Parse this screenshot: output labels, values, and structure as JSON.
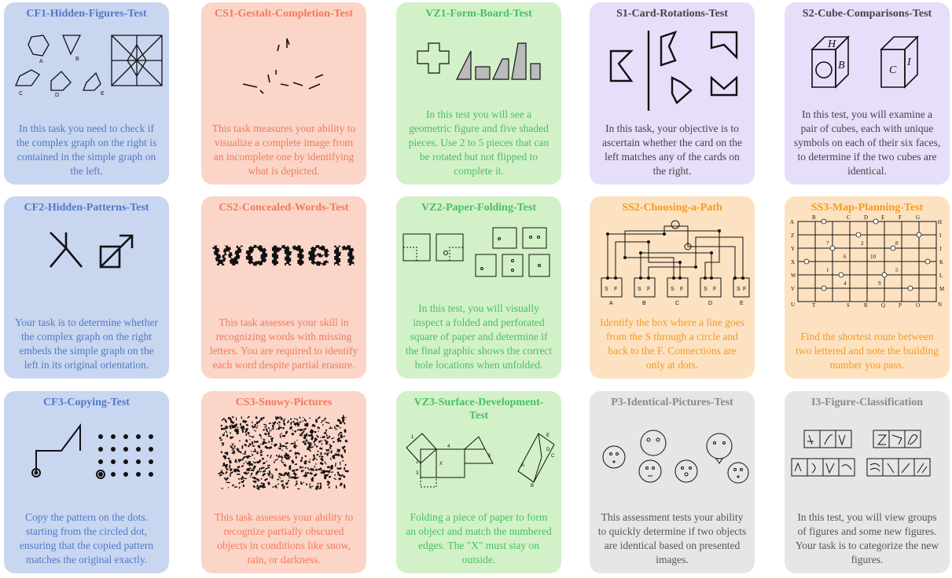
{
  "cards": [
    {
      "id": "cf1",
      "title": "CF1-Hidden-Figures-Test",
      "desc": "In this task you need to check if the complex graph on the right is contained in the simple graph on the left.",
      "color": "blue",
      "fig_labels": [
        "A",
        "B",
        "C",
        "D",
        "E"
      ]
    },
    {
      "id": "cs1",
      "title": "CS1-Gestalt-Completion-Test",
      "desc": "This task measures your ability to visualize a complete image from an incomplete one by identifying what is depicted.",
      "color": "red"
    },
    {
      "id": "vz1",
      "title": "VZ1-Form-Board-Test",
      "desc": "In this test you will see a geometric figure and five shaded pieces. Use 2 to 5 pieces that can be rotated but not flipped to complete it.",
      "color": "green"
    },
    {
      "id": "s1",
      "title": "S1-Card-Rotations-Test",
      "desc": "In this task, your objective is to ascertain whether the card on the left matches any of the cards on the right.",
      "color": "purple"
    },
    {
      "id": "s2",
      "title": "S2-Cube-Comparisons-Test",
      "desc": "In this test, you will examine a pair of cubes, each with unique symbols on each of their six faces, to determine if the two cubes are identical.",
      "color": "purple",
      "fig_labels": [
        "H",
        "B",
        "C",
        "I"
      ]
    },
    {
      "id": "cf2",
      "title": "CF2-Hidden-Patterns-Test",
      "desc": "Your task is to determine whether the complex graph on the right embeds the simple graph on the left in its original orientation.",
      "color": "blue"
    },
    {
      "id": "cs2",
      "title": "CS2-Concealed-Words-Test",
      "desc": "This task assesses your skill in recognizing words with missing letters. You are required to identify each word despite partial erasure.",
      "color": "red",
      "fig_labels": [
        "women"
      ]
    },
    {
      "id": "vz2",
      "title": "VZ2-Paper-Folding-Test",
      "desc": "In this test, you will visually inspect a folded and perforated square of paper and determine if the final graphic shows the correct hole locations when unfolded.",
      "color": "green"
    },
    {
      "id": "ss2",
      "title": "SS2-Choosing-a-Path",
      "desc": "Identify the box where a line goes from the S through a circle and back to the F. Connections are only at dots.",
      "color": "orange",
      "fig_labels": [
        "S",
        "F",
        "A",
        "B",
        "C",
        "D",
        "E"
      ]
    },
    {
      "id": "ss3",
      "title": "SS3-Map-Planning-Test",
      "desc": "Find the shortest route between two lettered and note the building number you pass.",
      "color": "orange",
      "fig_labels": [
        "A",
        "B",
        "C",
        "D",
        "E",
        "F",
        "G",
        "H",
        "I",
        "J",
        "K",
        "L",
        "M",
        "N",
        "O",
        "P",
        "Q",
        "R",
        "S",
        "T",
        "U",
        "V",
        "W",
        "X",
        "Y",
        "Z",
        "1",
        "2",
        "4",
        "5",
        "6",
        "7",
        "8",
        "9",
        "10"
      ]
    },
    {
      "id": "cf3",
      "title": "CF3-Copying-Test",
      "desc": "Copy the pattern on the dots. starting from the circled dot, ensuring that the copied pattern matches the original exactly.",
      "color": "blue"
    },
    {
      "id": "cs3",
      "title": "CS3-Snowy-Pictures",
      "desc": "This task assesses your ability to recognize partially obscured objects in conditions like snow, rain, or darkness.",
      "color": "red"
    },
    {
      "id": "vz3",
      "title": "VZ3-Surface-Development-Test",
      "desc": "Folding a piece of paper to form an object and match the numbered edges. The \"X\" must stay on outside.",
      "color": "green",
      "fig_labels": [
        "1",
        "2",
        "3",
        "4",
        "5",
        "X",
        "A",
        "B",
        "C",
        "D",
        "E"
      ]
    },
    {
      "id": "p3",
      "title": "P3-Identical-Pictures-Test",
      "desc": "This assessment tests your ability to quickly determine if two objects are identical based on presented images.",
      "color": "gray"
    },
    {
      "id": "i3",
      "title": "I3-Figure-Classification",
      "desc": "In this test, you will view groups of figures and some new figures. Your task is to categorize the new figures.",
      "color": "gray"
    }
  ]
}
